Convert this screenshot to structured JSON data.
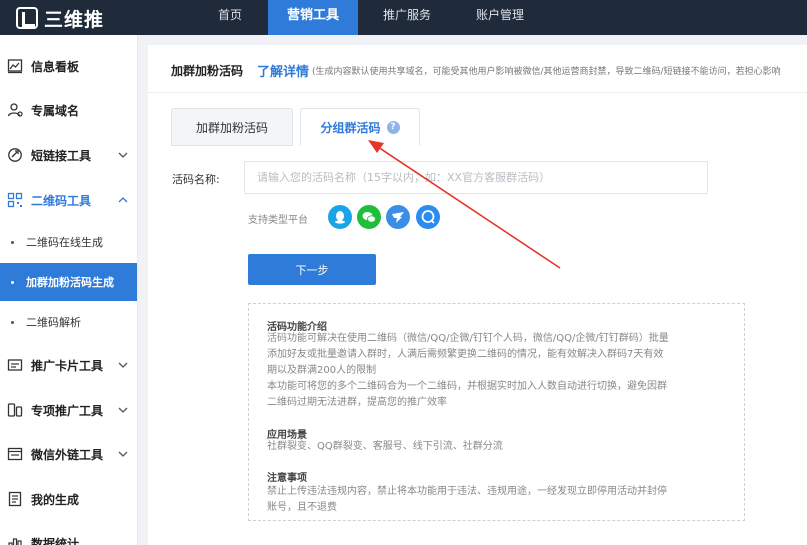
{
  "brand": {
    "name": "三维推"
  },
  "topnav": [
    {
      "label": "首页"
    },
    {
      "label": "营销工具",
      "active": true
    },
    {
      "label": "推广服务"
    },
    {
      "label": "账户管理"
    }
  ],
  "sidebar": {
    "items": [
      {
        "label": "信息看板",
        "icon": "dashboard-icon"
      },
      {
        "label": "专属域名",
        "icon": "user-icon"
      },
      {
        "label": "短链接工具",
        "icon": "link-icon",
        "expandable": true
      },
      {
        "label": "二维码工具",
        "icon": "qrcode-icon",
        "expanded": true
      },
      {
        "label": "推广卡片工具",
        "icon": "card-icon",
        "expandable": true
      },
      {
        "label": "专项推广工具",
        "icon": "phone-icon",
        "expandable": true
      },
      {
        "label": "微信外链工具",
        "icon": "wechat-link-icon",
        "expandable": true
      },
      {
        "label": "我的生成",
        "icon": "list-icon"
      },
      {
        "label": "数据统计",
        "icon": "chart-icon"
      }
    ],
    "sub_items": [
      {
        "label": "二维码在线生成"
      },
      {
        "label": "加群加粉活码生成",
        "active": true
      },
      {
        "label": "二维码解析"
      }
    ]
  },
  "header": {
    "title": "加群加粉活码",
    "link": "了解详情",
    "note": "(生成内容默认使用共享域名，可能受其他用户影响被微信/其他运营商封禁，导致二维码/短链接不能访问，若担心影响"
  },
  "tabs": [
    {
      "label": "加群加粉活码"
    },
    {
      "label": "分组群活码",
      "active": true,
      "help": "?"
    }
  ],
  "form": {
    "name_label": "活码名称:",
    "name_placeholder": "请输入您的活码名称（15字以内，如：XX官方客服群活码）",
    "platform_label": "支持类型平台",
    "platforms": [
      {
        "name": "qq-icon",
        "color": "#1aa4e6"
      },
      {
        "name": "wechat-icon",
        "color": "#1fbe3b"
      },
      {
        "name": "dingtalk-icon",
        "color": "#3a8ee6"
      },
      {
        "name": "enterprise-wechat-icon",
        "color": "#2a8cf0"
      }
    ],
    "next_label": "下一步"
  },
  "intro": {
    "sec1_title": "活码功能介绍",
    "sec1_l1": "活码功能可解决在使用二维码（微信/QQ/企微/钉钉个人码，微信/QQ/企微/钉钉群码）批量",
    "sec1_l2": "添加好友或批量邀请入群时，人满后需频繁更换二维码的情况，能有效解决入群码7天有效",
    "sec1_l3": "期以及群满200人的限制",
    "sec1_l4": "本功能可将您的多个二维码合为一个二维码，并根据实时加入人数自动进行切换，避免因群",
    "sec1_l5": "二维码过期无法进群，提高您的推广效率",
    "sec2_title": "应用场景",
    "sec2_l1": "社群裂变、QQ群裂变、客服号、线下引流、社群分流",
    "sec3_title": "注意事项",
    "sec3_l1": "禁止上传违法违规内容，禁止将本功能用于违法、违规用途，一经发现立即停用活动并封停",
    "sec3_l2": "账号，且不退费"
  },
  "colors": {
    "primary": "#2f7bd9",
    "topbar": "#1f2a3a",
    "arrow": "#e5362c"
  }
}
